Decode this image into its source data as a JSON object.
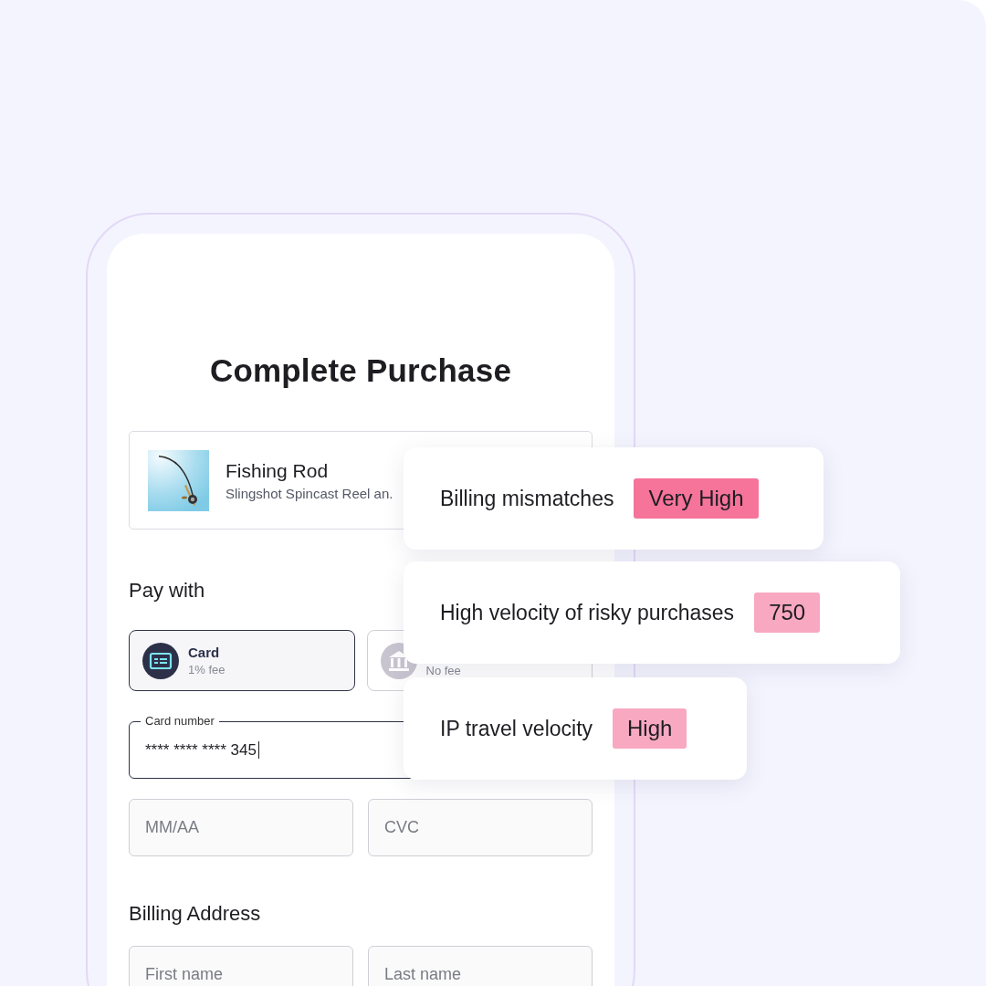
{
  "checkout": {
    "title": "Complete Purchase",
    "product": {
      "name": "Fishing Rod",
      "description": "Slingshot Spincast Reel an."
    },
    "pay_with": {
      "heading": "Pay with",
      "options": [
        {
          "kind": "card",
          "label": "Card",
          "fee": "1% fee",
          "selected": true
        },
        {
          "kind": "bank",
          "fee": "No fee",
          "selected": false
        }
      ]
    },
    "card_number": {
      "label": "Card number",
      "value": "**** **** **** 345"
    },
    "expiry": {
      "placeholder": "MM/AA"
    },
    "cvc": {
      "placeholder": "CVC"
    },
    "billing": {
      "heading": "Billing Address",
      "fields": [
        {
          "placeholder": "First name"
        },
        {
          "placeholder": "Last name"
        }
      ]
    }
  },
  "risk_signals": [
    {
      "label": "Billing mismatches",
      "value": "Very High",
      "color": "#f6739a"
    },
    {
      "label": "High velocity of risky purchases",
      "value": "750",
      "color": "#f8a8c1"
    },
    {
      "label": "IP travel velocity",
      "value": "High",
      "color": "#f8a8c1"
    }
  ]
}
